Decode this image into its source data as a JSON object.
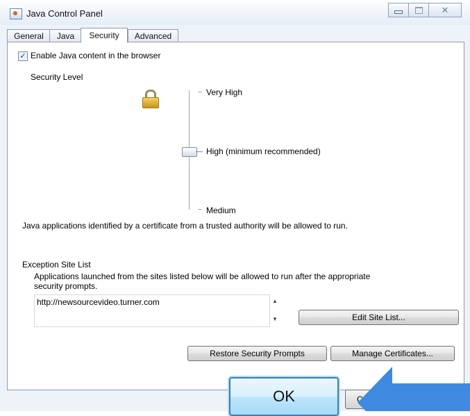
{
  "window": {
    "title": "Java Control Panel"
  },
  "tabs": [
    {
      "label": "General"
    },
    {
      "label": "Java"
    },
    {
      "label": "Security"
    },
    {
      "label": "Advanced"
    }
  ],
  "security": {
    "enable_checkbox_label": "Enable Java content in the browser",
    "enable_checked": true,
    "level_heading": "Security Level",
    "levels": [
      "Very High",
      "High (minimum recommended)",
      "Medium"
    ],
    "selected_level": "High (minimum recommended)",
    "level_description": "Java applications identified by a certificate from a trusted authority will be allowed to run."
  },
  "exceptions": {
    "heading": "Exception Site List",
    "description_line1": "Applications launched from the sites listed below will be allowed to run after the appropriate",
    "description_line2": "security prompts.",
    "sites": [
      "http://newsourcevideo.turner.com"
    ],
    "edit_button": "Edit Site List..."
  },
  "buttons": {
    "restore": "Restore Security Prompts",
    "manage": "Manage Certificates...",
    "ok": "OK",
    "cancel": "Ca"
  },
  "colors": {
    "pointer_arrow": "#3f8ae0",
    "ok_highlight": "#3c7fb1"
  },
  "icons": [
    "java-app-icon",
    "lock-icon",
    "minimize-icon",
    "maximize-icon",
    "close-icon",
    "scroll-up-icon",
    "scroll-down-icon",
    "pointer-arrow-icon"
  ]
}
